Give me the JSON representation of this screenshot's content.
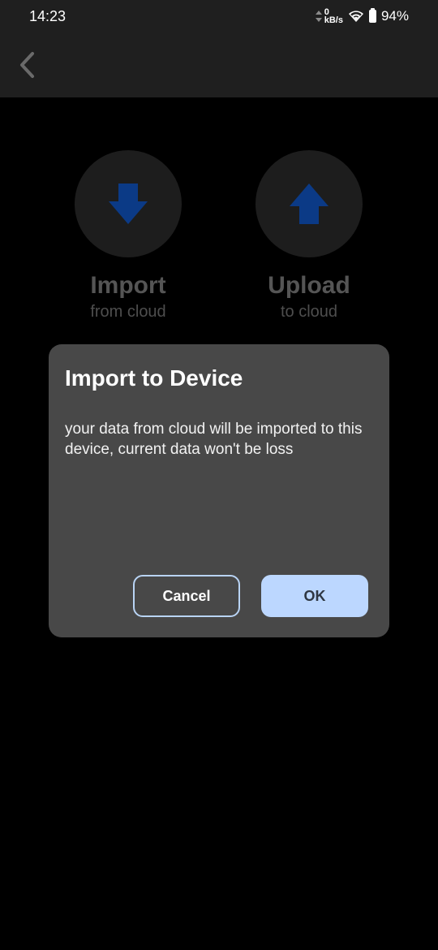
{
  "status_bar": {
    "time": "14:23",
    "net_speed_value": "0",
    "net_speed_unit": "kB/s",
    "battery": "94%"
  },
  "app_bar": {
    "back_icon": "chevron-left-icon"
  },
  "actions": {
    "import": {
      "title": "Import",
      "subtitle": "from cloud",
      "icon": "arrow-down-icon"
    },
    "upload": {
      "title": "Upload",
      "subtitle": "to cloud",
      "icon": "arrow-up-icon"
    }
  },
  "dialog": {
    "title": "Import to Device",
    "message": "your data from cloud will be imported to this device, current data won't be loss",
    "cancel_label": "Cancel",
    "ok_label": "OK"
  },
  "colors": {
    "arrow_blue": "#0b3a86",
    "ok_button": "#bcd7ff",
    "dialog_bg": "#484848"
  }
}
